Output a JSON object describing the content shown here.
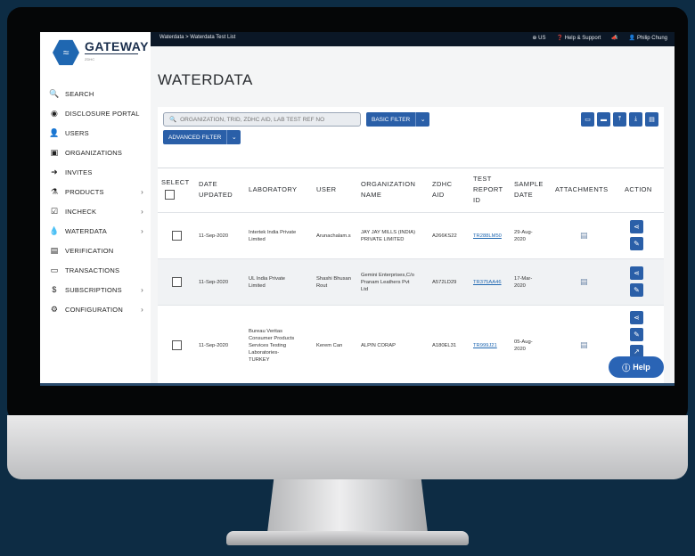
{
  "app": {
    "name": "GATEWAY",
    "tagline": "ZDHC"
  },
  "topbar": {
    "breadcrumb": "Waterdata > Waterdata Test List",
    "region": "US",
    "help_support": "Help & Support",
    "user": "Philip Chung"
  },
  "sidebar": {
    "items": [
      {
        "label": "SEARCH",
        "icon": "search-icon",
        "glyph": "🔍",
        "chevron": false
      },
      {
        "label": "DISCLOSURE PORTAL",
        "icon": "globe-icon",
        "glyph": "◉",
        "chevron": false
      },
      {
        "label": "USERS",
        "icon": "user-icon",
        "glyph": "👤",
        "chevron": false
      },
      {
        "label": "ORGANIZATIONS",
        "icon": "briefcase-icon",
        "glyph": "▣",
        "chevron": false
      },
      {
        "label": "INVITES",
        "icon": "sign-in-icon",
        "glyph": "➜",
        "chevron": false
      },
      {
        "label": "PRODUCTS",
        "icon": "flask-icon",
        "glyph": "⚗",
        "chevron": true
      },
      {
        "label": "INCHECK",
        "icon": "checkbox-icon",
        "glyph": "☑",
        "chevron": true
      },
      {
        "label": "WATERDATA",
        "icon": "droplet-icon",
        "glyph": "💧",
        "chevron": true
      },
      {
        "label": "VERIFICATION",
        "icon": "file-icon",
        "glyph": "▤",
        "chevron": false
      },
      {
        "label": "TRANSACTIONS",
        "icon": "card-icon",
        "glyph": "▭",
        "chevron": false
      },
      {
        "label": "SUBSCRIPTIONS",
        "icon": "dollar-icon",
        "glyph": "$",
        "chevron": true
      },
      {
        "label": "CONFIGURATION",
        "icon": "gear-icon",
        "glyph": "⚙",
        "chevron": true
      }
    ]
  },
  "main": {
    "title": "WATERDATA",
    "search_placeholder": "ORGANIZATION, TRID, ZDHC AID, LAB TEST REF NO",
    "basic_filter": "BASIC FILTER",
    "advanced_filter": "ADVANCED FILTER",
    "columns": {
      "select": "SELECT",
      "date_updated": [
        "DATE",
        "UPDATED"
      ],
      "laboratory": "LABORATORY",
      "user": "USER",
      "organization": [
        "ORGANIZATION",
        "NAME"
      ],
      "zdhc_aid": [
        "ZDHC",
        "AID"
      ],
      "test_report": [
        "TEST",
        "REPORT",
        "ID"
      ],
      "sample_date": [
        "SAMPLE",
        "DATE"
      ],
      "attachments": "ATTACHMENTS",
      "action": "ACTION"
    },
    "rows": [
      {
        "date": "11-Sep-2020",
        "lab": [
          "Intertek India Private",
          "Limited"
        ],
        "user": [
          "Arunachalam.s"
        ],
        "org": [
          "JAY JAY MILLS (INDIA)",
          "PRIVATE LIMITED"
        ],
        "aid": "A266KS22",
        "report": "TR288LM50",
        "sample": [
          "29-Aug-",
          "2020"
        ]
      },
      {
        "date": "11-Sep-2020",
        "lab": [
          "UL India Private",
          "Limited"
        ],
        "user": [
          "Shashi Bhusan",
          "Rout"
        ],
        "org": [
          "Gemini Enterprises,C/o",
          "Pranam Leathers Pvt",
          "Ltd"
        ],
        "aid": "A572LD29",
        "report": "TR375AA46",
        "sample": [
          "17-Mar-",
          "2020"
        ]
      },
      {
        "date": "11-Sep-2020",
        "lab": [
          "Bureau Veritas",
          "Consumer Products",
          "Services Testing",
          "Laboratories-",
          "TURKEY"
        ],
        "user": [
          "Kerem Can"
        ],
        "org": [
          "ALPIN CORAP"
        ],
        "aid": "A180EL31",
        "report": "TR999J21",
        "sample": [
          "05-Aug-",
          "2020"
        ]
      }
    ]
  },
  "help_button": "Help",
  "colors": {
    "primary": "#2a5fa8",
    "brand": "#1f67b1",
    "dark": "#0b1726"
  }
}
